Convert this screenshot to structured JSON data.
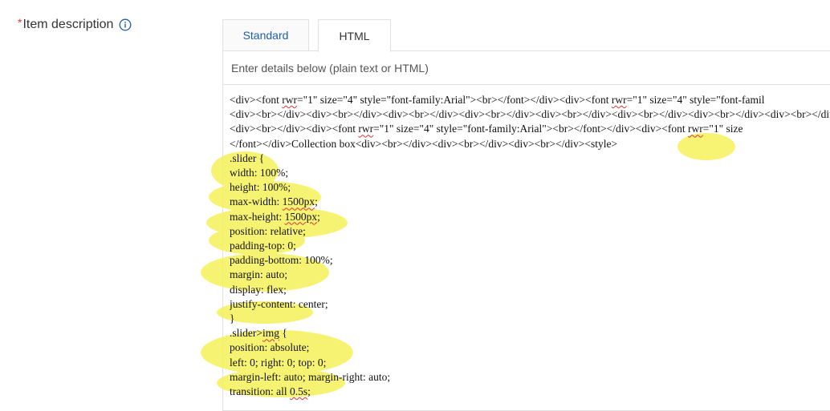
{
  "field": {
    "required_mark": "*",
    "label": "Item description",
    "info_icon": "info-circle-icon"
  },
  "tabs": [
    {
      "label": "Standard",
      "active": false
    },
    {
      "label": "HTML",
      "active": true
    }
  ],
  "editor": {
    "hint": "Enter details below (plain text or HTML)",
    "lines": [
      "<div><font rwr=\"1\" size=\"4\" style=\"font-family:Arial\"><br></font></div><div><font rwr=\"1\" size=\"4\" style=\"font-famil",
      "<div><br></div><div><br></div><div><br></div><div><br></div><div><br></div><div><br></div><div><br></div><div><br></div><div><br>",
      "<div><br></div><div><font rwr=\"1\" size=\"4\" style=\"font-family:Arial\"><br></font></div><div><font rwr=\"1\" size",
      "</font></div>Collection box<div><br></div><div><br></div><div><br></div><style>",
      ".slider {",
      "width: 100%;",
      "height: 100%;",
      "max-width: 1500px;",
      "max-height: 1500px;",
      "position: relative;",
      "padding-top: 0;",
      "padding-bottom: 100%;",
      "margin: auto;",
      "display: flex;",
      "justify-content: center;",
      "}",
      ".slider>img {",
      "position: absolute;",
      "left: 0; right: 0; top: 0;",
      "margin-left: auto; margin-right: auto;",
      "transition: all 0.5s;"
    ]
  },
  "colors": {
    "highlight": "#f6f25a",
    "link_tab": "#1f5fa8",
    "required": "#e0393e"
  }
}
